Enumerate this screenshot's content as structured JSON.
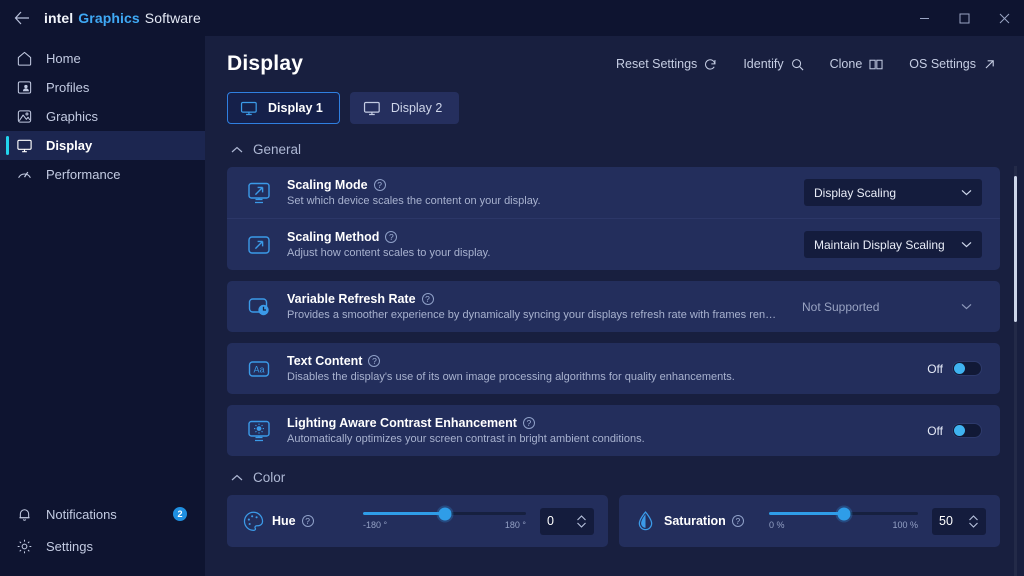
{
  "titlebar": {
    "back_icon": "back-arrow-icon",
    "brand_intel": "intel",
    "brand_graphics": "Graphics",
    "brand_software": "Software",
    "minimize_label": "–",
    "maximize_label": "☐",
    "close_label": "✕"
  },
  "sidebar": {
    "items": [
      {
        "label": "Home",
        "icon": "home-icon"
      },
      {
        "label": "Profiles",
        "icon": "profiles-icon"
      },
      {
        "label": "Graphics",
        "icon": "graphics-image-icon"
      },
      {
        "label": "Display",
        "icon": "display-monitor-icon"
      },
      {
        "label": "Performance",
        "icon": "performance-pulse-icon"
      }
    ],
    "bottom": [
      {
        "label": "Notifications",
        "icon": "bell-icon",
        "badge": "2"
      },
      {
        "label": "Settings",
        "icon": "gear-icon"
      }
    ]
  },
  "header": {
    "title": "Display",
    "actions": [
      {
        "label": "Reset Settings",
        "icon": "refresh-icon"
      },
      {
        "label": "Identify",
        "icon": "search-icon"
      },
      {
        "label": "Clone",
        "icon": "clone-panels-icon"
      },
      {
        "label": "OS Settings",
        "icon": "external-link-arrow-icon"
      }
    ],
    "tabs": [
      {
        "label": "Display 1",
        "active": true
      },
      {
        "label": "Display 2",
        "active": false
      }
    ]
  },
  "sections": {
    "general": {
      "title": "General",
      "rows": [
        {
          "title": "Scaling Mode",
          "desc": "Set which device scales the content on your display.",
          "icon": "scaling-mode-monitor-icon",
          "control": "select",
          "value": "Display Scaling"
        },
        {
          "title": "Scaling Method",
          "desc": "Adjust how content scales to your display.",
          "icon": "scaling-method-icon",
          "control": "select",
          "value": "Maintain Display Scaling"
        }
      ],
      "rows2": [
        {
          "title": "Variable Refresh Rate",
          "desc": "Provides a smoother experience by dynamically syncing your displays refresh rate with frames rendered by your gr...",
          "icon": "refresh-rate-clock-icon",
          "control": "select-disabled",
          "value": "Not Supported"
        }
      ],
      "rows3": [
        {
          "title": "Text Content",
          "desc": "Disables the display's use of its own image processing algorithms for quality enhancements.",
          "icon": "text-content-aa-icon",
          "control": "toggle",
          "value": "Off"
        }
      ],
      "rows4": [
        {
          "title": "Lighting Aware Contrast Enhancement",
          "desc": "Automatically optimizes your screen contrast in bright ambient conditions.",
          "icon": "lighting-contrast-icon",
          "control": "toggle",
          "value": "Off"
        }
      ]
    },
    "color": {
      "title": "Color",
      "sliders": [
        {
          "title": "Hue",
          "icon": "palette-icon",
          "min_label": "-180 °",
          "max_label": "180 °",
          "value": "0",
          "percent": 50
        },
        {
          "title": "Saturation",
          "icon": "droplet-icon",
          "min_label": "0 %",
          "max_label": "100 %",
          "value": "50",
          "percent": 50
        }
      ]
    }
  },
  "colors": {
    "accent": "#2f9de8",
    "active_indicator": "#22d3ee",
    "page_bg": "#181f3f",
    "card_bg": "#232e5c",
    "sidebar_bg": "#0e1430",
    "badge": "#1f8fe0"
  }
}
